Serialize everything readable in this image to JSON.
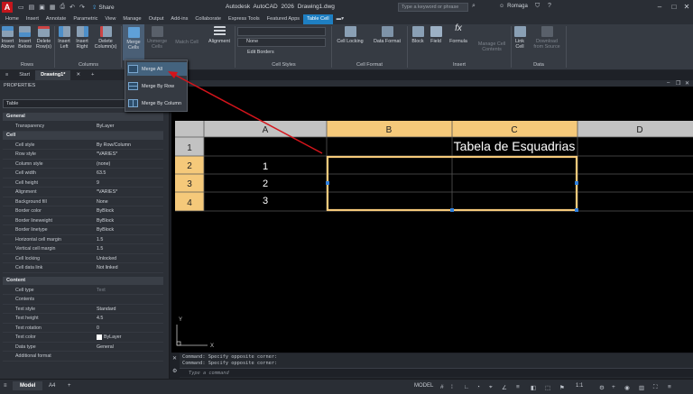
{
  "title_bar": {
    "app_icon": "A",
    "app_title": "Autodesk AutoCAD 2026    Drawing1.dwg",
    "share_label": "Share",
    "search_placeholder": "Type a keyword or phrase",
    "user_name": "Romaga"
  },
  "ribbon_tabs": [
    "Home",
    "Insert",
    "Annotate",
    "Parametric",
    "View",
    "Manage",
    "Output",
    "Add-ins",
    "Collaborate",
    "Express Tools",
    "Featured Apps",
    "Table Cell"
  ],
  "active_tab": "Table Cell",
  "ribbon": {
    "rows_buttons": [
      "Insert Above",
      "Insert Below",
      "Delete Row(s)"
    ],
    "columns_buttons": [
      "Insert Left",
      "Insert Right",
      "Delete Column(s)"
    ],
    "merge_label": "Merge Cells",
    "unmerge_label": "Unmerge Cells",
    "match_cell_label": "Match Cell",
    "alignment_label": "Alignment",
    "cell_style_value": "",
    "border_value": "None",
    "edit_borders_label": "Edit Borders",
    "cell_locking_label": "Cell Locking",
    "data_format_label": "Data Format",
    "block_label": "Block",
    "field_label": "Field",
    "formula_label": "Formula",
    "manage_content_label": "Manage Cell Contents",
    "link_cell_label": "Link Cell",
    "download_label": "Download from Source",
    "panels": [
      "Rows",
      "Columns",
      "Cell Styles",
      "Cell Format",
      "Insert",
      "Data"
    ]
  },
  "merge_menu": [
    "Merge All",
    "Merge By Row",
    "Merge By Column"
  ],
  "file_tabs": {
    "start": "Start",
    "drawing": "Drawing1*"
  },
  "properties": {
    "heading": "PROPERTIES",
    "selection": "Table",
    "sections": {
      "general": "General",
      "cell": "Cell",
      "content": "Content"
    },
    "general_rows": [
      {
        "k": "Transparency",
        "v": "ByLayer"
      }
    ],
    "cell_rows": [
      {
        "k": "Cell style",
        "v": "By Row/Column"
      },
      {
        "k": "Row style",
        "v": "*VARIES*"
      },
      {
        "k": "Column style",
        "v": "(none)"
      },
      {
        "k": "Cell width",
        "v": "63.5"
      },
      {
        "k": "Cell height",
        "v": "9"
      },
      {
        "k": "Alignment",
        "v": "*VARIES*"
      },
      {
        "k": "Background fill",
        "v": "None"
      },
      {
        "k": "Border color",
        "v": "ByBlock"
      },
      {
        "k": "Border lineweight",
        "v": "ByBlock"
      },
      {
        "k": "Border linetype",
        "v": "ByBlock"
      },
      {
        "k": "Horizontal cell margin",
        "v": "1.5"
      },
      {
        "k": "Vertical cell margin",
        "v": "1.5"
      },
      {
        "k": "Cell locking",
        "v": "Unlocked"
      },
      {
        "k": "Cell data link",
        "v": "Not linked"
      }
    ],
    "content_rows": [
      {
        "k": "Cell type",
        "v": "Text"
      },
      {
        "k": "Contents",
        "v": ""
      },
      {
        "k": "Text style",
        "v": "Standard"
      },
      {
        "k": "Text height",
        "v": "4.5"
      },
      {
        "k": "Text rotation",
        "v": "0"
      },
      {
        "k": "Text color",
        "v": "ByLayer"
      },
      {
        "k": "Data type",
        "v": "General"
      },
      {
        "k": "Additional format",
        "v": ""
      }
    ]
  },
  "table": {
    "col_headers": [
      "A",
      "B",
      "C",
      "D"
    ],
    "row_headers": [
      "1",
      "2",
      "3",
      "4"
    ],
    "title_cell": "Tabela de Esquadrias",
    "col_a_values": [
      "1",
      "2",
      "3"
    ]
  },
  "command": {
    "history": [
      "Command: Specify opposite corner:",
      "Command: Specify opposite corner:"
    ],
    "placeholder": "Type a command"
  },
  "status": {
    "model_tab": "Model",
    "layout_tab": "A4",
    "model_label": "MODEL",
    "scale": "1:1"
  },
  "ucs": {
    "y": "Y",
    "x": "X"
  },
  "colors": {
    "accent": "#1e7fc2",
    "table_header": "#f5c97a",
    "selection": "#f5c97a",
    "annotation_arrow": "#d4141b"
  }
}
